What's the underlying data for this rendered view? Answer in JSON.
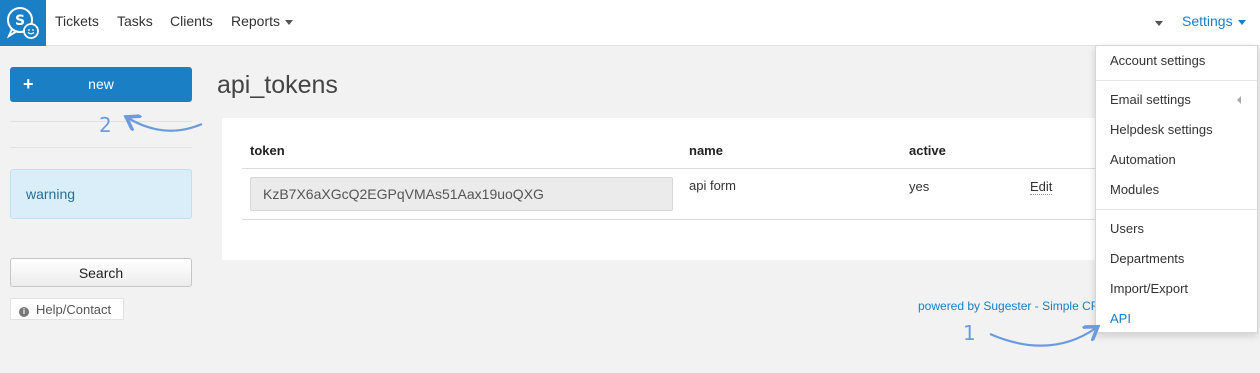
{
  "nav": {
    "tickets": "Tickets",
    "tasks": "Tasks",
    "clients": "Clients",
    "reports": "Reports",
    "settings": "Settings"
  },
  "sidebar": {
    "new_label": "new",
    "warning_text": "warning",
    "search_label": "Search",
    "help_label": "Help/Contact"
  },
  "main": {
    "title": "api_tokens",
    "table": {
      "headers": {
        "token": "token",
        "name": "name",
        "active": "active"
      },
      "row": {
        "token": "KzB7X6aXGcQ2EGPqVMAs51Aax19uoQXG",
        "name": "api form",
        "active": "yes",
        "edit": "Edit"
      }
    },
    "footer": "powered by Sugester - Simple CRM"
  },
  "settings_menu": {
    "account_settings": "Account settings",
    "email_settings": "Email settings",
    "helpdesk_settings": "Helpdesk settings",
    "automation": "Automation",
    "modules": "Modules",
    "users": "Users",
    "departments": "Departments",
    "import_export": "Import/Export",
    "api": "API"
  },
  "annotations": {
    "one": "1",
    "two": "2"
  },
  "colors": {
    "accent": "#1a7fc4",
    "annotation": "#6b9bdf",
    "warning_bg": "#d9eef8"
  },
  "icons": {
    "logo": "chat-smile-logo",
    "plus": "plus-icon",
    "info": "info-icon"
  }
}
